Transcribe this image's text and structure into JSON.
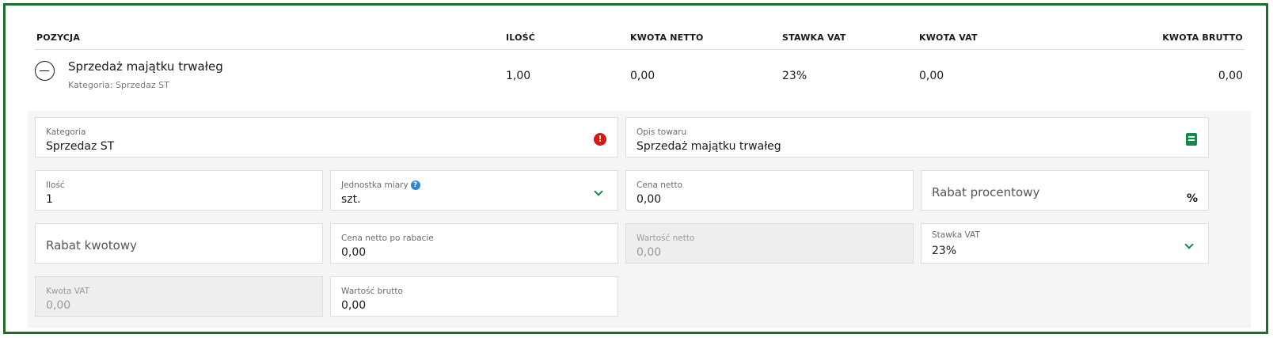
{
  "table": {
    "headers": {
      "position": "POZYCJA",
      "quantity": "ILOŚĆ",
      "net_amount": "KWOTA NETTO",
      "vat_rate": "STAWKA VAT",
      "vat_amount": "KWOTA VAT",
      "gross_amount": "KWOTA BRUTTO"
    },
    "row": {
      "name": "Sprzedaż majątku trwałeg",
      "category": "Kategoria: Sprzedaz ST",
      "quantity": "1,00",
      "net_amount": "0,00",
      "vat_rate": "23%",
      "vat_amount": "0,00",
      "gross_amount": "0,00"
    }
  },
  "form": {
    "category": {
      "label": "Kategoria",
      "value": "Sprzedaz ST",
      "icon": "error-icon",
      "icon_glyph": "!"
    },
    "description": {
      "label": "Opis towaru",
      "value": "Sprzedaż majątku trwałeg",
      "icon": "book-icon"
    },
    "quantity": {
      "label": "Ilość",
      "value": "1"
    },
    "unit": {
      "label": "Jednostka miary",
      "value": "szt.",
      "help_glyph": "?"
    },
    "net_price": {
      "label": "Cena netto",
      "value": "0,00"
    },
    "percent_discount": {
      "placeholder": "Rabat procentowy",
      "suffix": "%"
    },
    "amount_discount": {
      "placeholder": "Rabat kwotowy"
    },
    "net_price_after_discount": {
      "label": "Cena netto po rabacie",
      "value": "0,00"
    },
    "net_value": {
      "label": "Wartość netto",
      "value": "0,00",
      "disabled": true
    },
    "vat_rate": {
      "label": "Stawka VAT",
      "value": "23%"
    },
    "vat_amount": {
      "label": "Kwota VAT",
      "value": "0,00",
      "disabled": true
    },
    "gross_value": {
      "label": "Wartość brutto",
      "value": "0,00"
    }
  },
  "colors": {
    "frame_border": "#1f6b2e",
    "accent_green": "#0f8a47",
    "error_red": "#d41b12",
    "help_blue": "#2f86d6",
    "form_background": "#f5f5f5"
  }
}
